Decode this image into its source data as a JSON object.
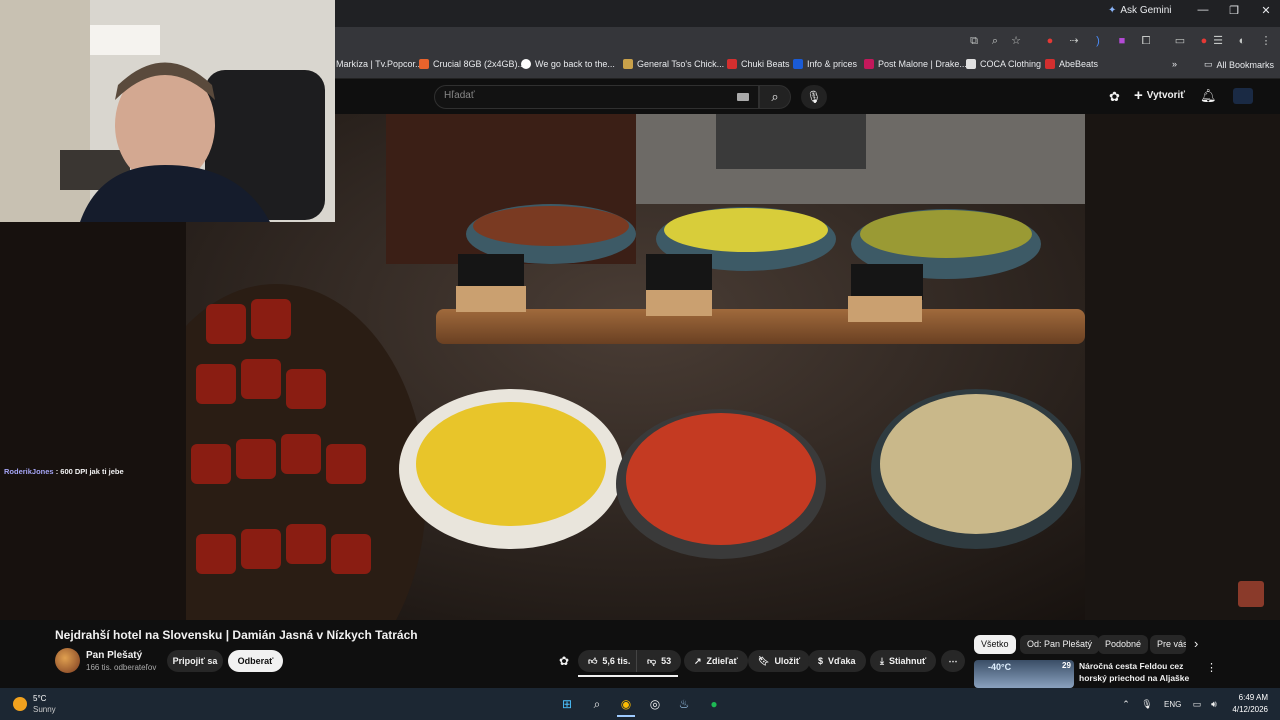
{
  "browser": {
    "gemini_label": "Ask Gemini",
    "bookmarks": [
      {
        "label": "Markíza | Tv.Popcor...",
        "color": "#444"
      },
      {
        "label": "Crucial 8GB (2x4GB)...",
        "color": "#e8632c"
      },
      {
        "label": "We go back to the...",
        "color": "#ffffff"
      },
      {
        "label": "General Tso's Chick...",
        "color": "#c9a14a"
      },
      {
        "label": "Chuki Beats",
        "color": "#d32f2f"
      },
      {
        "label": "Info & prices",
        "color": "#1a5bd6"
      },
      {
        "label": "Post Malone | Drake...",
        "color": "#c2185b"
      },
      {
        "label": "COCA Clothing",
        "color": "#e0e0e0"
      },
      {
        "label": "AbeBeats",
        "color": "#d32f2f"
      }
    ],
    "all_bookmarks": "All Bookmarks"
  },
  "youtube": {
    "search_placeholder": "Hľadať",
    "create_label": "Vytvoriť",
    "video_title": "Nejdrahší hotel na Slovensku | Damián Jasná v Nízkych Tatrách",
    "channel_name": "Pan Plešatý",
    "subscribers": "166 tis. odberateľov",
    "join_label": "Pripojiť sa",
    "subscribe_label": "Odberať",
    "likes": "5,6 tis.",
    "dislikes": "53",
    "share_label": "Zdieľať",
    "save_label": "Uložiť",
    "thanks_label": "Vďaka",
    "download_label": "Stiahnuť",
    "chips": [
      "Všetko",
      "Od: Pan Plešatý",
      "Podobné",
      "Pre vás"
    ],
    "recommendation": {
      "title": "Náročná cesta Feldou cez horský priechod na Aljaške na ...",
      "badge": "29",
      "thumb_text": "-40°C"
    }
  },
  "chat": {
    "user": "RoderikJones",
    "message": " : 600 DPI jak ti jebe"
  },
  "taskbar": {
    "temperature": "5°C",
    "weather": "Sunny",
    "language": "ENG",
    "time": "6:49 AM",
    "date": "4/12/2026"
  }
}
